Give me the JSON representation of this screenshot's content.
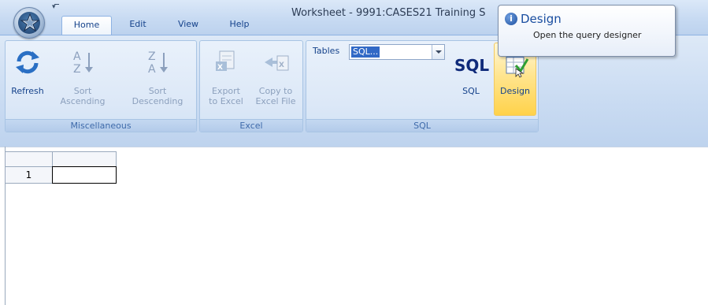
{
  "window": {
    "title": "Worksheet - 9991:CASES21 Training S"
  },
  "tabs": [
    {
      "label": "Home",
      "active": true
    },
    {
      "label": "Edit",
      "active": false
    },
    {
      "label": "View",
      "active": false
    },
    {
      "label": "Help",
      "active": false
    }
  ],
  "ribbon": {
    "groups": {
      "miscellaneous": {
        "label": "Miscellaneous",
        "buttons": {
          "refresh": "Refresh",
          "sort_asc_line1": "Sort",
          "sort_asc_line2": "Ascending",
          "sort_desc_line1": "Sort",
          "sort_desc_line2": "Descending"
        }
      },
      "excel": {
        "label": "Excel",
        "buttons": {
          "export_line1": "Export",
          "export_line2": "to Excel",
          "copy_line1": "Copy to",
          "copy_line2": "Excel File"
        }
      },
      "sql": {
        "label": "SQL",
        "tables_label": "Tables",
        "tables_value": "SQL...",
        "sql_icon_text": "SQL",
        "sql_button": "SQL",
        "design_button": "Design"
      }
    }
  },
  "tooltip": {
    "title": "Design",
    "description": "Open the query designer"
  },
  "sheet": {
    "row_numbers": [
      "1"
    ]
  },
  "colors": {
    "ribbon_text": "#15428b",
    "group_label": "#3e6aaa",
    "disabled_text": "#8ca0bd",
    "design_highlight": "#ffd24a",
    "selection": "#3169c6"
  }
}
